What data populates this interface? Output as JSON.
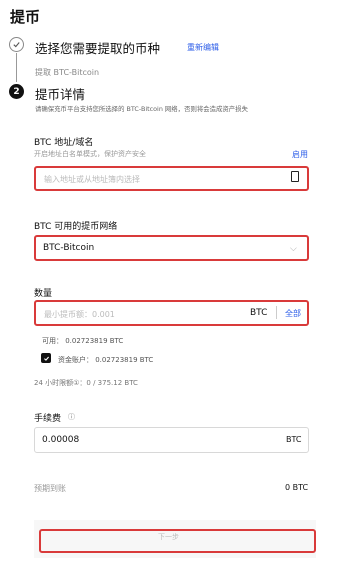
{
  "page": {
    "title": "提币"
  },
  "step1": {
    "title": "选择您需要提取的币种",
    "edit_link": "重新编辑",
    "selected": "提取 BTC-Bitcoin"
  },
  "step2": {
    "number": "2",
    "title": "提币详情",
    "notice": "请确保充币平台支持您所选择的 BTC-Bitcoin 网络，否则将会造成资产损失"
  },
  "address": {
    "label": "BTC 地址/域名",
    "hint": "开启地址白名单模式，保护资产安全",
    "enable_link": "启用",
    "placeholder": "输入地址或从地址簿内选择",
    "icon": "address-book-icon"
  },
  "network": {
    "label": "BTC 可用的提币网络",
    "value": "BTC-Bitcoin",
    "icon": "chevron-down-icon"
  },
  "amount": {
    "label": "数量",
    "placeholder": "最小提币额：0.001",
    "unit": "BTC",
    "max_link": "全部",
    "available": "可用：  0.02723819 BTC",
    "account_label": "资金账户：  0.02723819 BTC",
    "account_checked": true,
    "limit": "24 小时限额①：0 / 375.12 BTC"
  },
  "fee": {
    "label": "手续费",
    "info_icon": "ⓘ",
    "value": "0.00008",
    "unit": "BTC"
  },
  "receive": {
    "label": "预期到账",
    "value": "0 BTC"
  },
  "next_button": {
    "label": "下一步"
  },
  "colors": {
    "accent": "#2b5ce8",
    "highlight": "#d93a3a"
  }
}
